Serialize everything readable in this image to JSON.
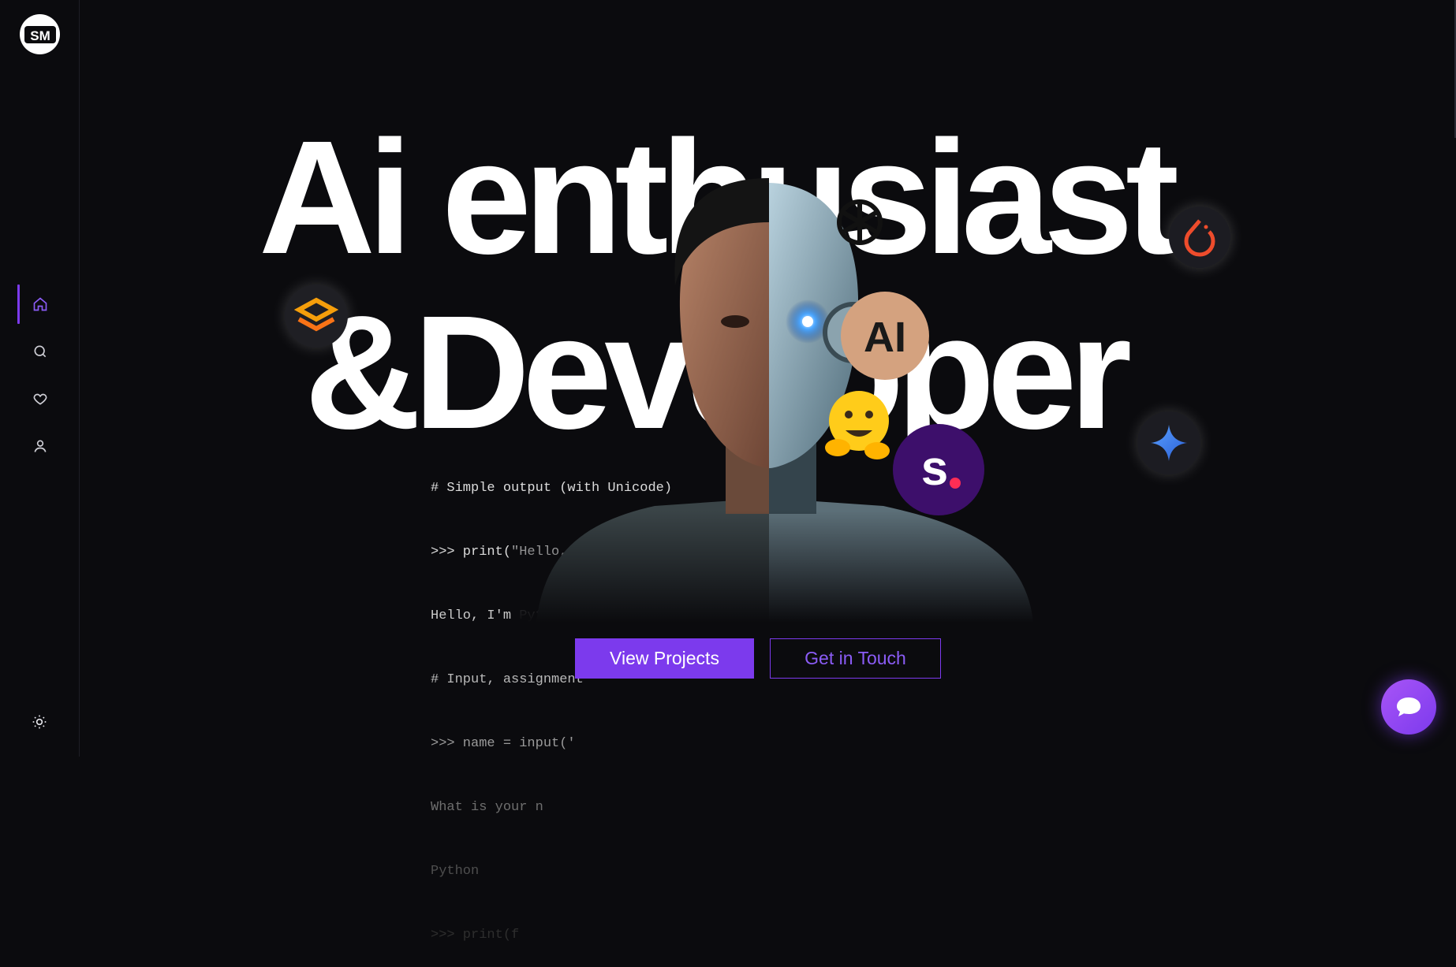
{
  "brand": {
    "logo_text": "SM",
    "accent_color": "#7c3aed"
  },
  "sidebar": {
    "items": [
      {
        "name": "home",
        "icon": "home-icon",
        "active": true
      },
      {
        "name": "search",
        "icon": "search-icon",
        "active": false
      },
      {
        "name": "favorites",
        "icon": "heart-icon",
        "active": false
      },
      {
        "name": "profile",
        "icon": "user-icon",
        "active": false
      }
    ],
    "theme_toggle_icon": "sun-icon"
  },
  "hero": {
    "line1": "Ai enthusiast",
    "line2": "&Developer",
    "code_lines": [
      "# Simple output (with Unicode)",
      ">>> print(\"Hello, I'm Python!\")",
      "Hello, I'm Python!",
      "# Input, assignment",
      ">>> name = input('",
      "What is your n",
      "Python",
      ">>> print(f"
    ],
    "tech_badges": [
      {
        "name": "stack-icon"
      },
      {
        "name": "openai-icon"
      },
      {
        "name": "pytorch-icon"
      },
      {
        "name": "anthropic-icon",
        "label": "AI"
      },
      {
        "name": "huggingface-icon"
      },
      {
        "name": "s-icon",
        "label": "s"
      },
      {
        "name": "gemini-icon"
      }
    ]
  },
  "actions": {
    "primary_label": "View Projects",
    "secondary_label": "Get in Touch"
  },
  "chat": {
    "icon": "chat-bubble-icon"
  }
}
